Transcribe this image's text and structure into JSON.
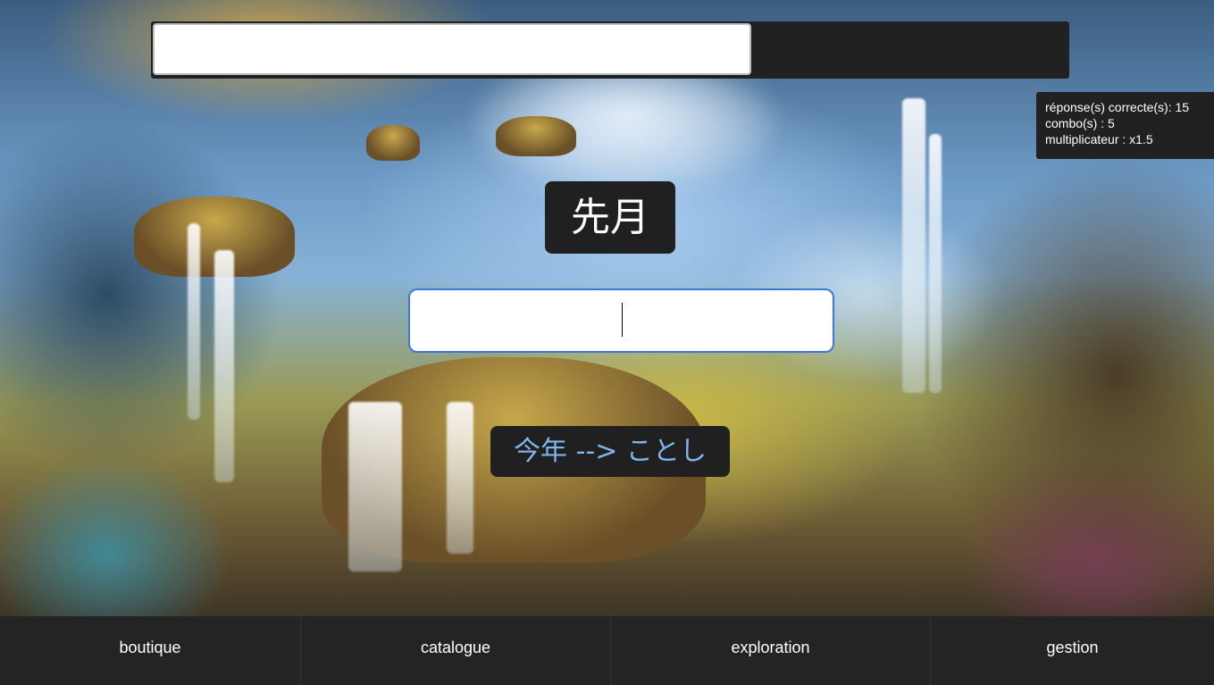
{
  "stats": {
    "correct": "réponse(s) correcte(s): 15",
    "combo": "combo(s) : 5",
    "multiplier": "multiplicateur : x1.5"
  },
  "question": {
    "kanji": "先月"
  },
  "answer": {
    "value": "",
    "placeholder": ""
  },
  "top_input": {
    "value": ""
  },
  "feedback": {
    "text": "今年 --> ことし"
  },
  "nav": {
    "items": [
      {
        "label": "boutique"
      },
      {
        "label": "catalogue"
      },
      {
        "label": "exploration"
      },
      {
        "label": "gestion"
      }
    ]
  },
  "colors": {
    "panel": "#212121",
    "accent_border": "#3b78d8",
    "feedback_text": "#7fb4ec"
  }
}
